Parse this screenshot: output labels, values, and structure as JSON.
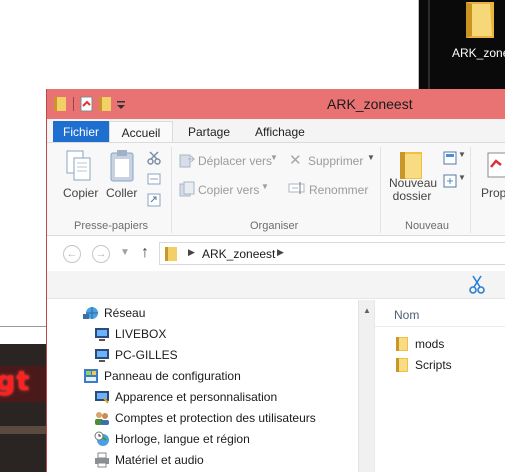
{
  "desktop": {
    "icon_label": "ARK_zone",
    "background_text": "gt"
  },
  "window": {
    "title": "ARK_zoneest"
  },
  "ribbon_tabs": {
    "file": "Fichier",
    "home": "Accueil",
    "share": "Partage",
    "view": "Affichage"
  },
  "ribbon": {
    "clipboard": {
      "copy": "Copier",
      "paste": "Coller",
      "group_label": "Presse-papiers"
    },
    "organize": {
      "move_to": "Déplacer vers",
      "copy_to": "Copier vers",
      "delete": "Supprimer",
      "rename": "Renommer",
      "group_label": "Organiser"
    },
    "new": {
      "new_folder_line1": "Nouveau",
      "new_folder_line2": "dossier",
      "group_label": "Nouveau"
    },
    "open": {
      "properties": "Propr"
    }
  },
  "address": {
    "path": "ARK_zoneest"
  },
  "nav_tree": [
    {
      "label": "Réseau",
      "icon": "network-icon"
    },
    {
      "label": "LIVEBOX",
      "icon": "computer-icon"
    },
    {
      "label": "PC-GILLES",
      "icon": "computer-icon"
    },
    {
      "label": "Panneau de configuration",
      "icon": "control-panel-icon"
    },
    {
      "label": "Apparence et personnalisation",
      "icon": "appearance-icon"
    },
    {
      "label": "Comptes et protection des utilisateurs",
      "icon": "users-icon"
    },
    {
      "label": "Horloge, langue et région",
      "icon": "clock-globe-icon"
    },
    {
      "label": "Matériel et audio",
      "icon": "printer-icon"
    }
  ],
  "file_list": {
    "column_name": "Nom",
    "items": [
      {
        "label": "mods",
        "icon": "folder-icon"
      },
      {
        "label": "Scripts",
        "icon": "folder-icon"
      }
    ]
  },
  "colors": {
    "titlebar": "#e87372",
    "file_tab": "#1e6fd0",
    "folder": "#f0c040"
  }
}
